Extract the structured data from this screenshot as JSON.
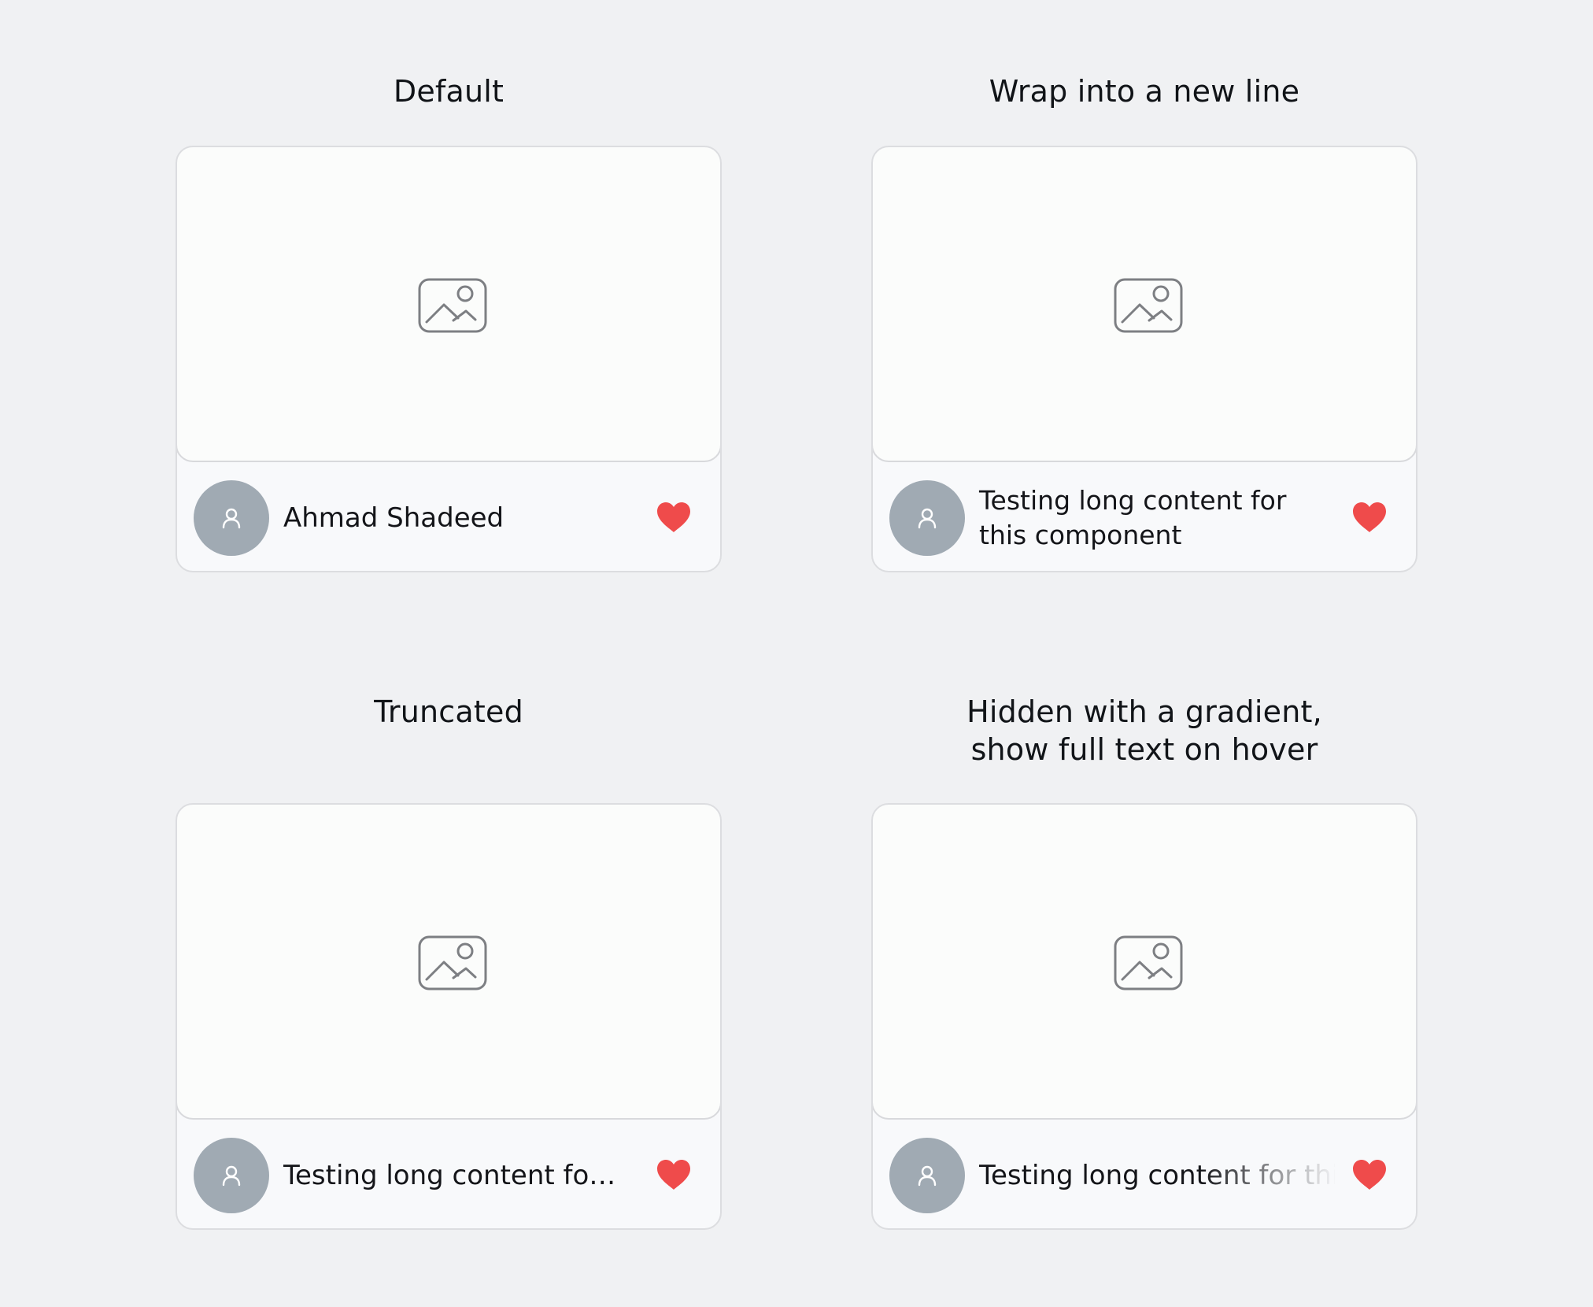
{
  "sections": [
    {
      "title": "Default",
      "author": "Ahmad Shadeed",
      "mode": "single"
    },
    {
      "title": "Wrap into a new line",
      "author": "Testing long content for this component",
      "mode": "wrap"
    },
    {
      "title": "Truncated",
      "author": "Testing long content for this component",
      "mode": "truncate"
    },
    {
      "title": "Hidden with a gradient, show full text on hover",
      "title_lines": [
        "Hidden with a gradient,",
        "show full text on hover"
      ],
      "author": "Testing long content for this component",
      "mode": "gradient"
    }
  ],
  "icons": {
    "thumbnail": "image-placeholder-icon",
    "avatar": "user-icon",
    "like": "heart-icon"
  },
  "colors": {
    "background": "#f0f1f3",
    "card": "#f8f9fb",
    "avatar": "#a0aab3",
    "heart": "#ef4b4b",
    "text": "#141519"
  }
}
